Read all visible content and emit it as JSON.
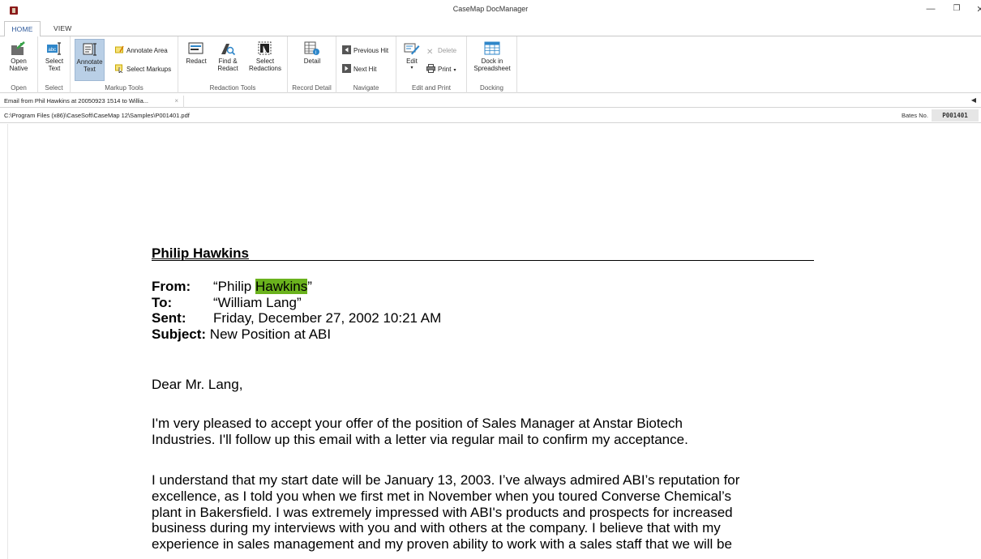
{
  "window": {
    "title": "CaseMap DocManager",
    "min": "—",
    "max": "❐",
    "close": "✕"
  },
  "ribbon_tabs": {
    "home": "HOME",
    "view": "VIEW"
  },
  "ribbon": {
    "open_native": {
      "line1": "Open",
      "line2": "Native",
      "group": "Open"
    },
    "select_text": {
      "line1": "Select",
      "line2": "Text",
      "group": "Select"
    },
    "annotate_text": {
      "line1": "Annotate",
      "line2": "Text"
    },
    "annotate_area": "Annotate Area",
    "select_markups": "Select Markups",
    "markup_group": "Markup Tools",
    "redact": "Redact",
    "find_redact": {
      "line1": "Find &",
      "line2": "Redact"
    },
    "select_redactions": {
      "line1": "Select",
      "line2": "Redactions"
    },
    "redaction_group": "Redaction Tools",
    "detail": "Detail",
    "record_group": "Record Detail",
    "previous_hit": "Previous Hit",
    "next_hit": "Next Hit",
    "navigate_group": "Navigate",
    "edit": "Edit",
    "delete": "Delete",
    "print": "Print",
    "edit_print_group": "Edit and Print",
    "dock": {
      "line1": "Dock in",
      "line2": "Spreadsheet"
    },
    "docking_group": "Docking"
  },
  "doc_tab": {
    "title": "Email from Phil Hawkins at 20050923 1514 to Willia...",
    "close": "×"
  },
  "path_bar": {
    "path": "C:\\Program Files (x86)\\CaseSoft\\CaseMap 12\\Samples\\P001401.pdf",
    "bates_label": "Bates No.",
    "bates_value": "P001401"
  },
  "document": {
    "header": "Philip Hawkins",
    "from_label": "From:",
    "from_prefix": "“Philip ",
    "from_highlight": "Hawkins",
    "from_suffix": "”",
    "to_label": "To:",
    "to_value": "“William Lang”",
    "sent_label": "Sent:",
    "sent_value": "Friday, December 27, 2002 10:21 AM",
    "subject_label": "Subject:",
    "subject_value": "New Position at ABI",
    "salutation": "Dear Mr. Lang,",
    "paragraph1": [
      "I'm very pleased to accept your offer of the position of Sales Manager at Anstar Biotech",
      "Industries.  I'll follow up this email with a letter via regular mail to confirm my acceptance."
    ],
    "paragraph2": [
      "I understand that my start date will be January 13, 2003.  I’ve always admired ABI’s reputation for",
      "excellence, as I told you when we first met in November when you toured Converse Chemical’s",
      "plant in Bakersfield.  I was extremely impressed with ABI's products and prospects for increased",
      "business during my interviews with you and with others at the company.  I believe that with my",
      "experience in sales management and my proven ability to work with a sales staff that we will be"
    ]
  },
  "colors": {
    "accent": "#2b579a",
    "highlight": "#6ab21d",
    "active_button": "#b9cfe6"
  }
}
